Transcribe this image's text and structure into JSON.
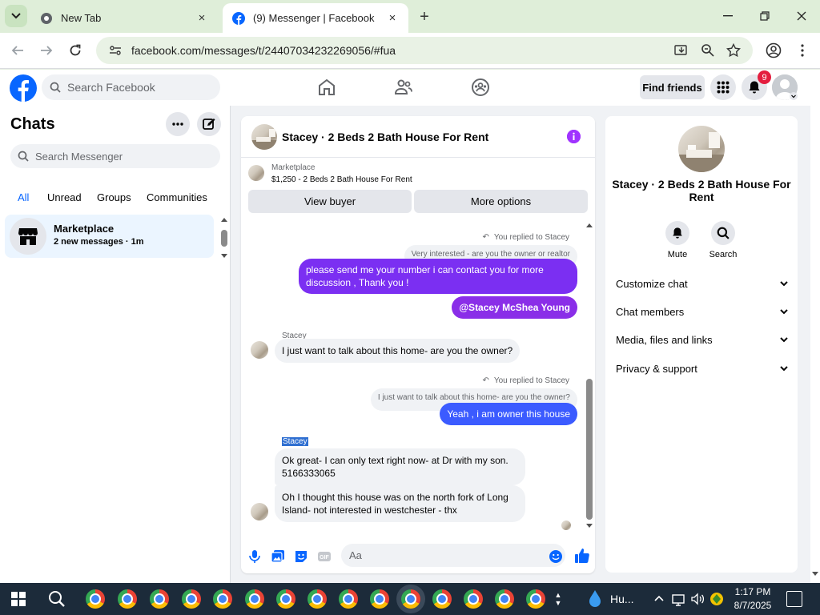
{
  "browser": {
    "tabs": [
      {
        "title": "New Tab",
        "active": false
      },
      {
        "title": "(9) Messenger | Facebook",
        "active": true
      }
    ],
    "url": "facebook.com/messages/t/24407034232269056/#fua",
    "new_tab_symbol": "+",
    "close_symbol": "×"
  },
  "fb_header": {
    "search_placeholder": "Search Facebook",
    "find_friends_label": "Find friends",
    "notification_count": "9",
    "nav_icons": [
      "home-icon",
      "friends-icon",
      "groups-icon"
    ]
  },
  "left_pane": {
    "title": "Chats",
    "search_placeholder": "Search Messenger",
    "filters": [
      "All",
      "Unread",
      "Groups",
      "Communities"
    ],
    "active_filter": "All",
    "chat_items": [
      {
        "name": "Marketplace",
        "subtitle": "2 new messages · 1m"
      }
    ]
  },
  "conversation": {
    "title": "Stacey · 2 Beds 2 Bath House For Rent",
    "banner": {
      "label": "Marketplace",
      "price_line": "$1,250 - 2 Beds 2 Bath House For Rent",
      "view_buyer_label": "View buyer",
      "more_options_label": "More options"
    },
    "messages": {
      "reply_note_1": "You replied to Stacey",
      "quote_1": "Very interested - are you the owner or realtor",
      "out_1": "please send me your number i can contact you for more discussion , Thank you !",
      "out_2": "@Stacey McShea Young",
      "sender_1": "Stacey",
      "in_1": "I just want to talk about this home- are you the owner?",
      "reply_note_2": "You replied to Stacey",
      "quote_2": "I just want to talk about this home- are you the owner?",
      "out_3": "Yeah , i am owner this house",
      "sender_2": "Stacey",
      "in_2": "Ok great- I can only text right now- at Dr with my son. 5166333065",
      "in_3": "Oh I thought this house was on the north fork of Long Island- not interested in westchester - thx"
    },
    "composer_placeholder": "Aa",
    "colors": {
      "outgoing_purple": "#7b2ff2",
      "outgoing_blue": "#3b5bff",
      "accent": "#0866ff"
    }
  },
  "right_pane": {
    "title": "Stacey · 2 Beds 2 Bath House For Rent",
    "actions": [
      {
        "label": "Mute",
        "icon": "bell-icon"
      },
      {
        "label": "Search",
        "icon": "search-icon"
      }
    ],
    "sections": [
      "Customize chat",
      "Chat members",
      "Media, files and links",
      "Privacy & support"
    ]
  },
  "taskbar": {
    "weather": "Hu...",
    "time": "1:17 PM",
    "date": "8/7/2025"
  }
}
